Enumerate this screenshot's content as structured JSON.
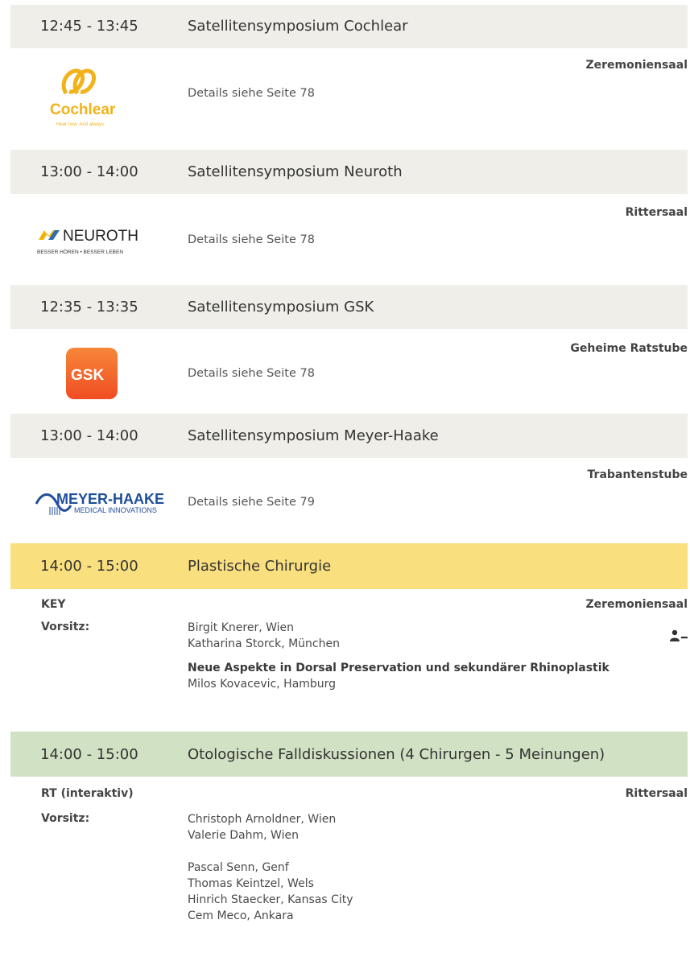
{
  "sessions": [
    {
      "time": "12:45 - 13:45",
      "title": "Satellitensymposium Cochlear",
      "room": "Zeremoniensaal",
      "details": "Details siehe Seite 78",
      "logo": {
        "name": "Cochlear",
        "tagline": "Hear now. And always",
        "color": "#f2b21a"
      }
    },
    {
      "time": "13:00 - 14:00",
      "title": "Satellitensymposium Neuroth",
      "room": "Rittersaal",
      "details": "Details siehe Seite 78",
      "logo": {
        "name": "NEUROTH",
        "tagline": "BESSER HÖREN • BESSER LEBEN",
        "color": "#f0b400"
      }
    },
    {
      "time": "12:35 - 13:35",
      "title": "Satellitensymposium GSK",
      "room": "Geheime Ratstube",
      "details": "Details siehe Seite 78",
      "logo": {
        "name": "GSK",
        "color": "#f36633"
      }
    },
    {
      "time": "13:00 - 14:00",
      "title": "Satellitensymposium Meyer-Haake",
      "room": "Trabantenstube",
      "details": "Details siehe Seite 79",
      "logo": {
        "name": "MEYER-HAAKE",
        "tagline": "MEDICAL INNOVATIONS",
        "color": "#1f4e9c"
      }
    }
  ],
  "plastic": {
    "time": "14:00 - 15:00",
    "title": "Plastische Chirurgie",
    "type": "KEY",
    "room": "Zeremoniensaal",
    "chair_label": "Vorsitz:",
    "chairs": [
      "Birgit Knerer, Wien",
      "Katharina Storck, München"
    ],
    "talk_title": "Neue Aspekte in Dorsal Preservation und sekundärer Rhinoplastik",
    "talk_speaker": "Milos Kovacevic, Hamburg",
    "icon": "presenter-icon",
    "color": "#fadf7f"
  },
  "otology": {
    "time": "14:00 - 15:00",
    "title": "Otologische Falldiskussionen (4 Chirurgen - 5 Meinungen)",
    "type": "RT (interaktiv)",
    "room": "Rittersaal",
    "chair_label": "Vorsitz:",
    "chairs": [
      "Christoph Arnoldner, Wien",
      "Valerie Dahm, Wien"
    ],
    "panel": [
      "Pascal Senn, Genf",
      "Thomas Keintzel, Wels",
      "Hinrich Staecker, Kansas City",
      "Cem Meco, Ankara"
    ],
    "color": "#d1e1c3"
  }
}
